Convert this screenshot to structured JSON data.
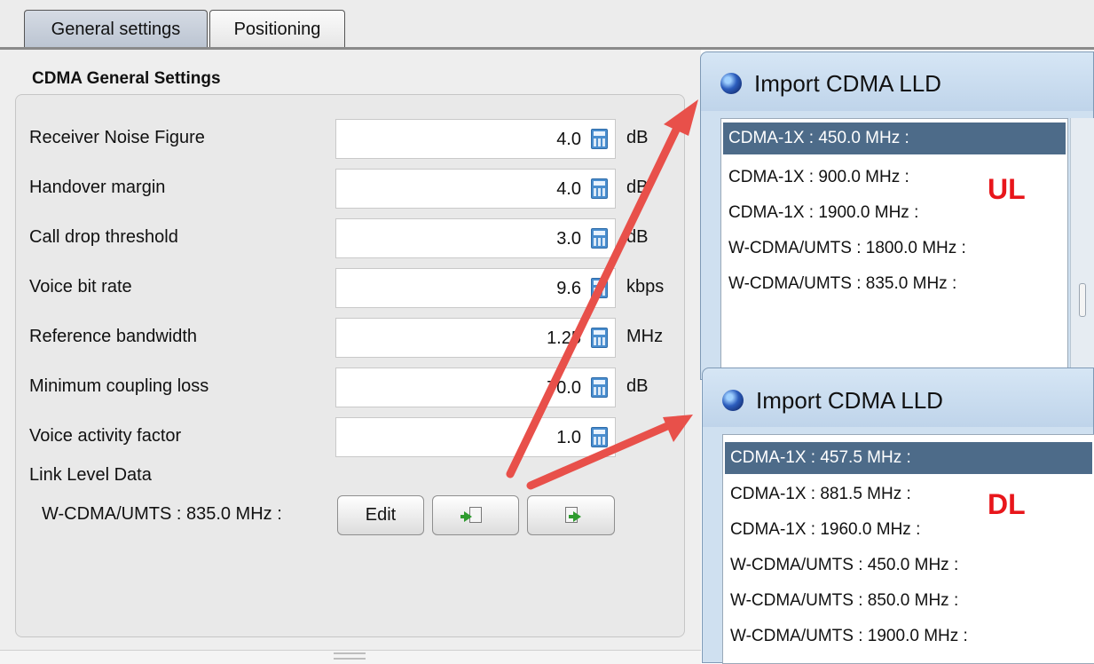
{
  "tabs": [
    {
      "label": "General settings",
      "active": true
    },
    {
      "label": "Positioning",
      "active": false
    }
  ],
  "panel": {
    "title": "CDMA General Settings",
    "rows": [
      {
        "label": "Receiver Noise Figure",
        "value": "4.0",
        "unit": "dB"
      },
      {
        "label": "Handover margin",
        "value": "4.0",
        "unit": "dB"
      },
      {
        "label": "Call drop threshold",
        "value": "3.0",
        "unit": "dB"
      },
      {
        "label": "Voice bit rate",
        "value": "9.6",
        "unit": "kbps"
      },
      {
        "label": "Reference bandwidth",
        "value": "1.25",
        "unit": "MHz"
      },
      {
        "label": "Minimum coupling loss",
        "value": "70.0",
        "unit": "dB"
      },
      {
        "label": "Voice activity factor",
        "value": "1.0",
        "unit": ""
      }
    ],
    "link_level": {
      "heading": "Link Level Data",
      "current": "W-CDMA/UMTS : 835.0 MHz :",
      "edit_label": "Edit",
      "import_icon": "import-icon",
      "export_icon": "export-icon"
    }
  },
  "dialog_ul": {
    "title": "Import CDMA LLD",
    "tag": "UL",
    "items": [
      "CDMA-1X : 450.0 MHz :",
      "CDMA-1X : 900.0 MHz :",
      "CDMA-1X : 1900.0 MHz :",
      "W-CDMA/UMTS : 1800.0 MHz :",
      "W-CDMA/UMTS : 835.0 MHz :"
    ],
    "selected_index": 0
  },
  "dialog_dl": {
    "title": "Import CDMA LLD",
    "tag": "DL",
    "items": [
      "CDMA-1X : 457.5 MHz :",
      "CDMA-1X : 881.5 MHz :",
      "CDMA-1X : 1960.0 MHz :",
      "W-CDMA/UMTS : 450.0 MHz :",
      "W-CDMA/UMTS : 850.0 MHz :",
      "W-CDMA/UMTS : 1900.0 MHz :"
    ],
    "selected_index": 0
  },
  "colors": {
    "arrow": "#e8504a",
    "tag": "#e8161b",
    "selection": "#4d6b89",
    "dialog_header": "#c9dcef"
  }
}
